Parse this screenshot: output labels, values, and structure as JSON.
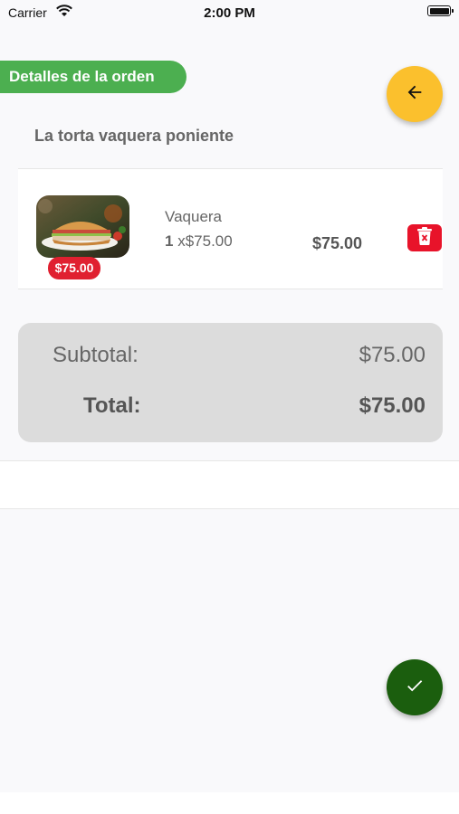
{
  "status_bar": {
    "carrier": "Carrier",
    "time": "2:00 PM"
  },
  "header": {
    "title": "Detalles de la orden",
    "back_icon": "arrow-left-icon"
  },
  "store": {
    "name": "La torta vaquera poniente"
  },
  "items": [
    {
      "name": "Vaquera",
      "quantity": "1",
      "unit_price": "x$75.00",
      "total": "$75.00",
      "badge_price": "$75.00",
      "image": "sandwich-photo",
      "delete_icon": "trash-x-icon"
    }
  ],
  "totals": {
    "subtotal_label": "Subtotal:",
    "subtotal_value": "$75.00",
    "total_label": "Total:",
    "total_value": "$75.00"
  },
  "actions": {
    "confirm_icon": "check-icon"
  },
  "colors": {
    "header_green": "#4caf50",
    "back_yellow": "#fbc02d",
    "badge_red": "#e02030",
    "confirm_green": "#1b5e0e"
  }
}
